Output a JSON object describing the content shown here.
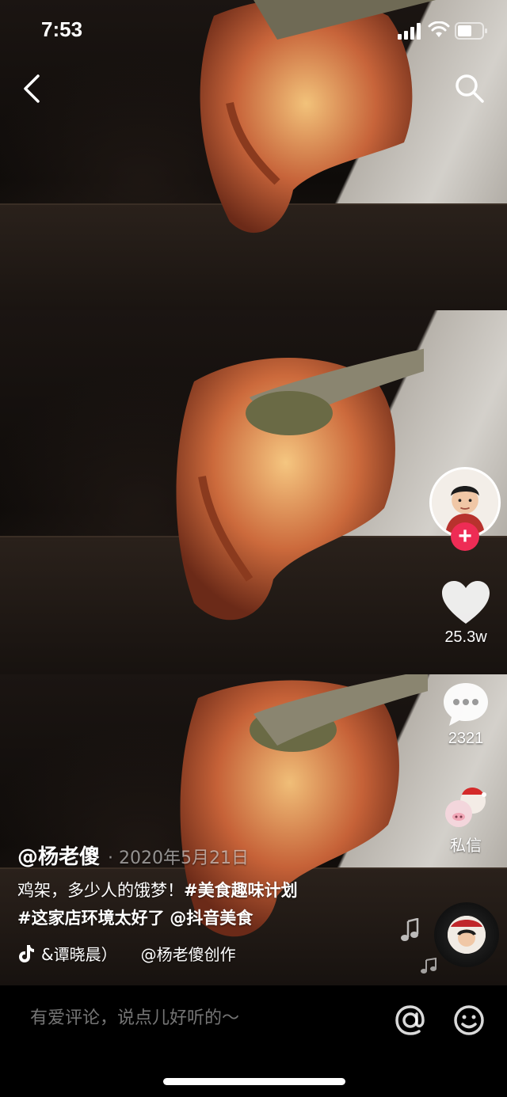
{
  "status_bar": {
    "time": "7:53"
  },
  "sidebar": {
    "likes": "25.3w",
    "comments": "2321",
    "share_label": "私信"
  },
  "caption": {
    "author": "@杨老傻",
    "date": "· 2020年5月21日",
    "text": "鸡架，多少人的饿梦！",
    "tag1": "#美食趣味计划",
    "tag2": "#这家店环境太好了",
    "mention": "@抖音美食",
    "music_left": "&谭晓晨）",
    "music_right": "@杨老傻创作"
  },
  "comment_bar": {
    "placeholder": "有爱评论，说点儿好听的～"
  },
  "colors": {
    "follow_accent": "#ee2c55",
    "background": "#000000"
  },
  "icons": [
    "back-icon",
    "search-icon",
    "heart-icon",
    "comment-bubble-icon",
    "music-note-icon",
    "at-icon",
    "emoji-icon",
    "tiktok-icon"
  ]
}
